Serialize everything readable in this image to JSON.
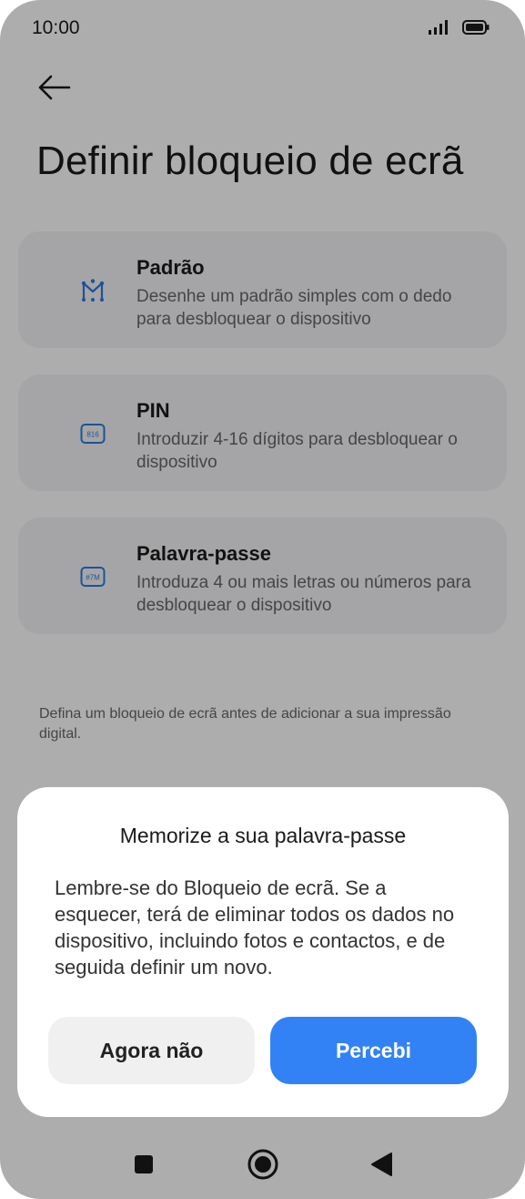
{
  "status_bar": {
    "time": "10:00",
    "icons": [
      "signal-icon",
      "battery-icon"
    ]
  },
  "header": {
    "back_icon": "arrow-left-icon",
    "title": "Definir bloqueio de ecrã"
  },
  "options": [
    {
      "icon": "pattern-icon",
      "title": "Padrão",
      "description": "Desenhe um padrão simples com o dedo para desbloquear o dispositivo"
    },
    {
      "icon": "pin-icon",
      "icon_text": "816",
      "title": "PIN",
      "description": "Introduzir 4-16 dígitos para desbloquear o dispositivo"
    },
    {
      "icon": "password-icon",
      "icon_text": "#7M",
      "title": "Palavra-passe",
      "description": "Introduza 4 ou mais letras ou números para desbloquear o dispositivo"
    }
  ],
  "hint": "Defina um bloqueio de ecrã antes de adicionar a sua impressão digital.",
  "dialog": {
    "title": "Memorize a sua palavra-passe",
    "body": "Lembre-se do Bloqueio de ecrã. Se a esquecer, terá de eliminar todos os dados no dispositivo, incluindo fotos e contactos, e de seguida definir um novo.",
    "cancel_label": "Agora não",
    "confirm_label": "Percebi"
  },
  "nav_bar": {
    "icons": [
      "recent-apps-icon",
      "home-icon",
      "back-icon"
    ]
  },
  "colors": {
    "accent": "#3282f6",
    "icon_blue": "#2a7ae4",
    "card_bg": "#f4f4f6",
    "overlay": "rgba(0,0,0,0.32)"
  }
}
